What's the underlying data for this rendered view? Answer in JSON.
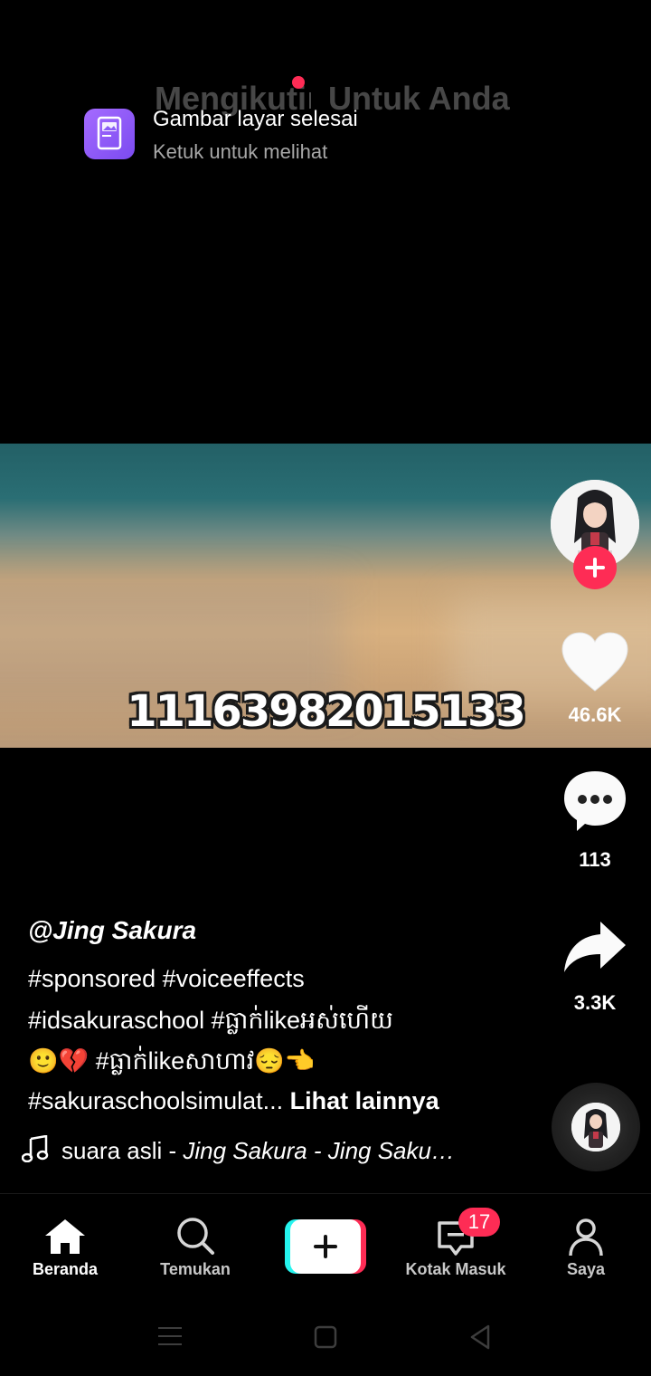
{
  "top_tabs": {
    "following": "Mengikuti",
    "for_you": "Untuk Anda"
  },
  "notification": {
    "title": "Gambar layar selesai",
    "subtitle": "Ketuk untuk melihat"
  },
  "video": {
    "overlay_number": "11163982015133"
  },
  "actions": {
    "likes": "46.6K",
    "comments": "113",
    "shares": "3.3K"
  },
  "caption": {
    "username": "@Jing Sakura",
    "line1": "#sponsored #voiceeffects",
    "line2": "#idsakuraschool #ធ្លាក់likeអស់ហើយ",
    "line3": "🙂💔 #ធ្លាក់likeសាហាវ😔👈",
    "line4": "#sakuraschoolsimulat...",
    "see_more": "Lihat lainnya"
  },
  "music": {
    "prefix": "suara asli - ",
    "artist": "Jing Sakura - Jing Saku…"
  },
  "bottom_nav": {
    "home": "Beranda",
    "discover": "Temukan",
    "inbox": "Kotak Masuk",
    "inbox_badge": "17",
    "profile": "Saya"
  },
  "colors": {
    "accent": "#fe2c55",
    "cyan": "#25f4ee",
    "notif_icon": "#8a5cf6"
  }
}
